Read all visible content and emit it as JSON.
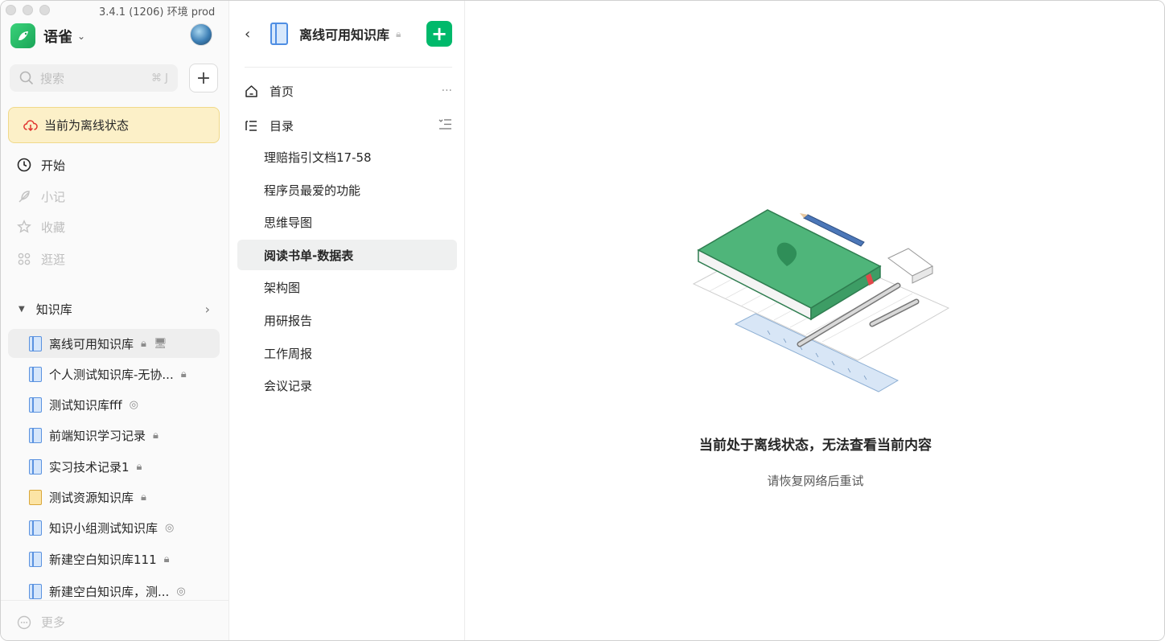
{
  "app": {
    "version": "3.4.1 (1206) 环境 prod",
    "name": "语雀"
  },
  "search": {
    "placeholder": "搜索",
    "shortcut": "⌘ J"
  },
  "offline": {
    "banner": "当前为离线状态"
  },
  "nav": {
    "start": "开始",
    "notes": "小记",
    "favorites": "收藏",
    "explore": "逛逛",
    "more": "更多"
  },
  "kb_section": {
    "title": "知识库",
    "items": [
      {
        "label": "离线可用知识库"
      },
      {
        "label": "个人测试知识库-无协..."
      },
      {
        "label": "测试知识库fff"
      },
      {
        "label": "前端知识学习记录"
      },
      {
        "label": "实习技术记录1"
      },
      {
        "label": "测试资源知识库"
      },
      {
        "label": "知识小组测试知识库"
      },
      {
        "label": "新建空白知识库111"
      },
      {
        "label": "新建空白知识库，测..."
      }
    ]
  },
  "book": {
    "title": "离线可用知识库",
    "home": "首页",
    "toc": "目录",
    "docs": [
      "理赔指引文档17-58",
      "程序员最爱的功能",
      "思维导图",
      "阅读书单-数据表",
      "架构图",
      "用研报告",
      "工作周报",
      "会议记录"
    ]
  },
  "main": {
    "title": "当前处于离线状态，无法查看当前内容",
    "subtitle": "请恢复网络后重试"
  },
  "colors": {
    "brand_green": "#00b96b",
    "offline_bg": "#fcf0c8",
    "book_blue": "#4f8ee3"
  }
}
